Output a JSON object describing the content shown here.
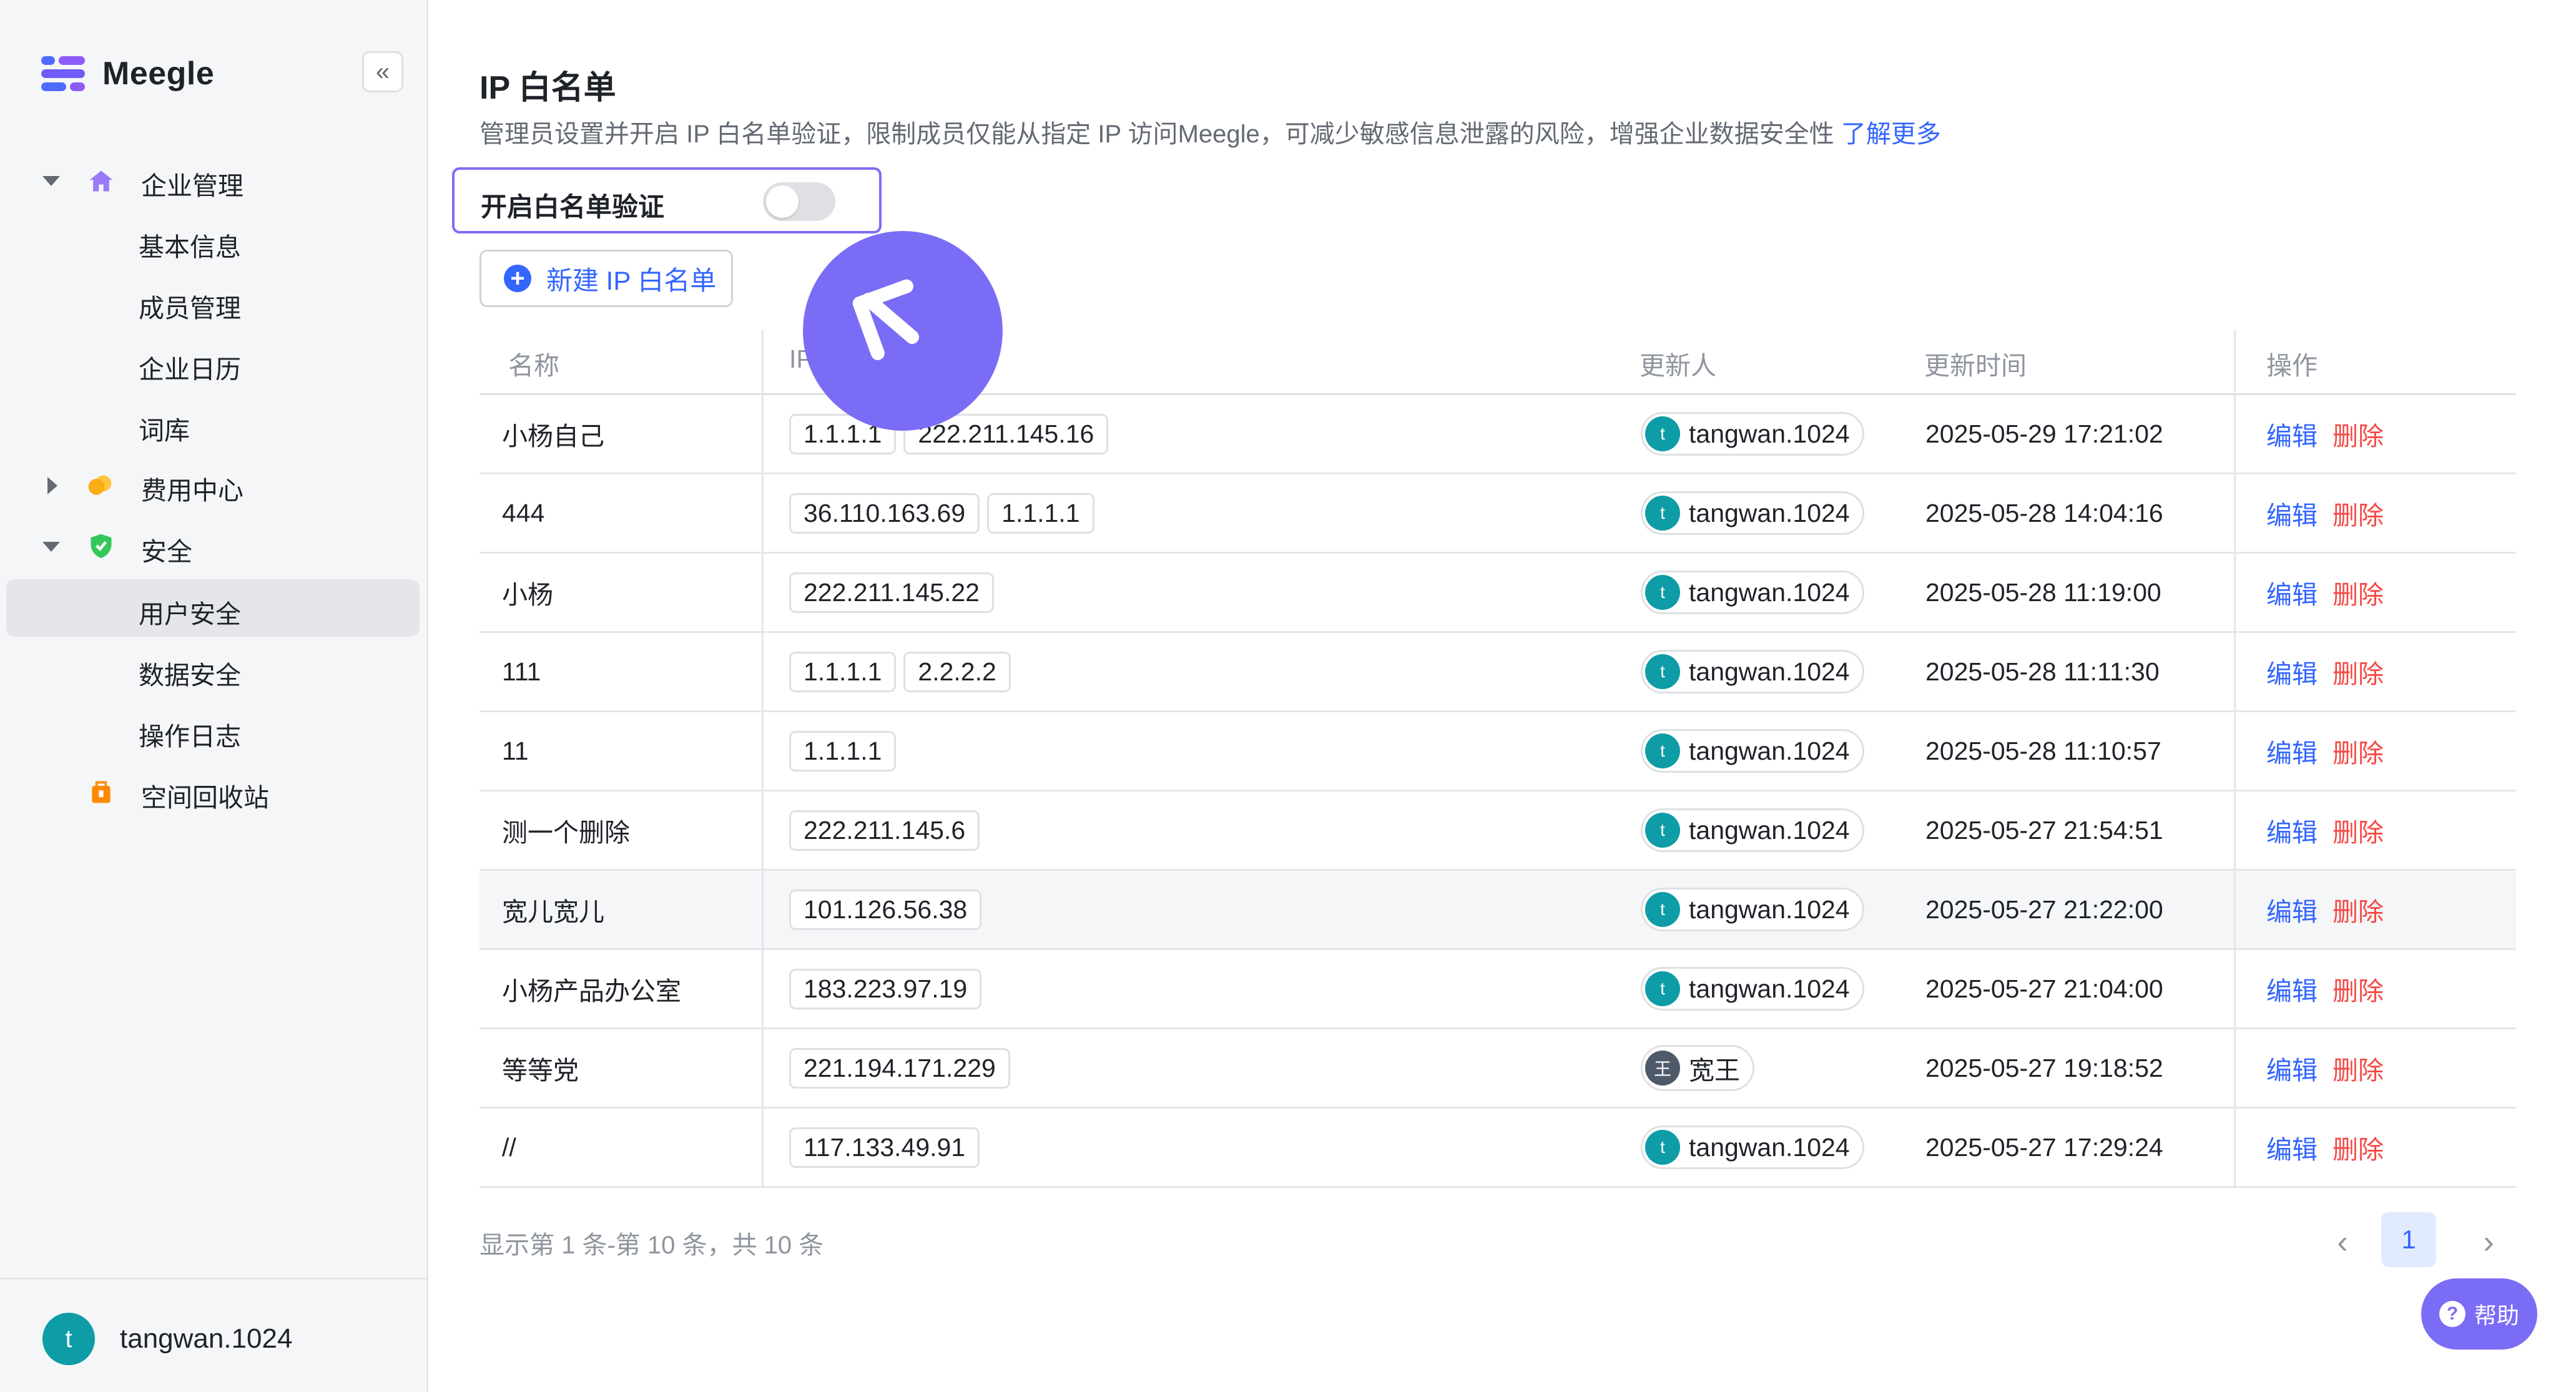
{
  "brand": {
    "name": "Meegle"
  },
  "sidebar": {
    "collapse_icon": "«",
    "groups": [
      {
        "label": "企业管理",
        "icon": "home-icon",
        "expanded": true,
        "items": [
          {
            "label": "基本信息"
          },
          {
            "label": "成员管理"
          },
          {
            "label": "企业日历"
          },
          {
            "label": "词库"
          }
        ]
      },
      {
        "label": "费用中心",
        "icon": "coins-icon",
        "expanded": false,
        "items": []
      },
      {
        "label": "安全",
        "icon": "shield-icon",
        "expanded": true,
        "items": [
          {
            "label": "用户安全",
            "active": true
          },
          {
            "label": "数据安全"
          },
          {
            "label": "操作日志"
          }
        ]
      },
      {
        "label": "空间回收站",
        "icon": "trash-bag-icon",
        "items": []
      }
    ],
    "user": {
      "initial": "t",
      "name": "tangwan.1024"
    }
  },
  "main": {
    "title": "IP 白名单",
    "description": "管理员设置并开启 IP 白名单验证，限制成员仅能从指定 IP 访问Meegle，可减少敏感信息泄露的风险，增强企业数据安全性",
    "learn_more": "了解更多",
    "toggle_label": "开启白名单验证",
    "toggle_on": false,
    "new_button": "新建 IP 白名单",
    "new_button_icon": "+"
  },
  "table": {
    "columns": {
      "name": "名称",
      "ip": "IP",
      "updater": "更新人",
      "updated_at": "更新时间",
      "actions": "操作"
    },
    "edit_label": "编辑",
    "delete_label": "删除",
    "rows": [
      {
        "name": "小杨自己",
        "ips": [
          "1.1.1.1",
          "222.211.145.16"
        ],
        "updater": "tangwan.1024",
        "updater_initial": "t",
        "time": "2025-05-29 17:21:02"
      },
      {
        "name": "444",
        "ips": [
          "36.110.163.69",
          "1.1.1.1"
        ],
        "updater": "tangwan.1024",
        "updater_initial": "t",
        "time": "2025-05-28 14:04:16"
      },
      {
        "name": "小杨",
        "ips": [
          "222.211.145.22"
        ],
        "updater": "tangwan.1024",
        "updater_initial": "t",
        "time": "2025-05-28 11:19:00"
      },
      {
        "name": "111",
        "ips": [
          "1.1.1.1",
          "2.2.2.2"
        ],
        "updater": "tangwan.1024",
        "updater_initial": "t",
        "time": "2025-05-28 11:11:30"
      },
      {
        "name": "11",
        "ips": [
          "1.1.1.1"
        ],
        "updater": "tangwan.1024",
        "updater_initial": "t",
        "time": "2025-05-28 11:10:57"
      },
      {
        "name": "测一个删除",
        "ips": [
          "222.211.145.6"
        ],
        "updater": "tangwan.1024",
        "updater_initial": "t",
        "time": "2025-05-27 21:54:51"
      },
      {
        "name": "宽儿宽儿",
        "ips": [
          "101.126.56.38"
        ],
        "updater": "tangwan.1024",
        "updater_initial": "t",
        "time": "2025-05-27 21:22:00",
        "highlight": true
      },
      {
        "name": "小杨产品办公室",
        "ips": [
          "183.223.97.19"
        ],
        "updater": "tangwan.1024",
        "updater_initial": "t",
        "time": "2025-05-27 21:04:00"
      },
      {
        "name": "等等党",
        "ips": [
          "221.194.171.229"
        ],
        "updater": "宽王",
        "updater_initial": "王",
        "time": "2025-05-27 19:18:52"
      },
      {
        "name": "//",
        "ips": [
          "117.133.49.91"
        ],
        "updater": "tangwan.1024",
        "updater_initial": "t",
        "time": "2025-05-27 17:29:24"
      }
    ]
  },
  "pagination": {
    "summary": "显示第 1 条-第 10 条，共 10 条",
    "current": "1",
    "prev_icon": "‹",
    "next_icon": "›"
  },
  "help": {
    "label": "帮助",
    "icon": "?"
  },
  "colors": {
    "accent": "#3366ff",
    "danger": "#f54a45",
    "brand_purple": "#7b6cf6",
    "avatar_teal": "#0e9ca6"
  }
}
